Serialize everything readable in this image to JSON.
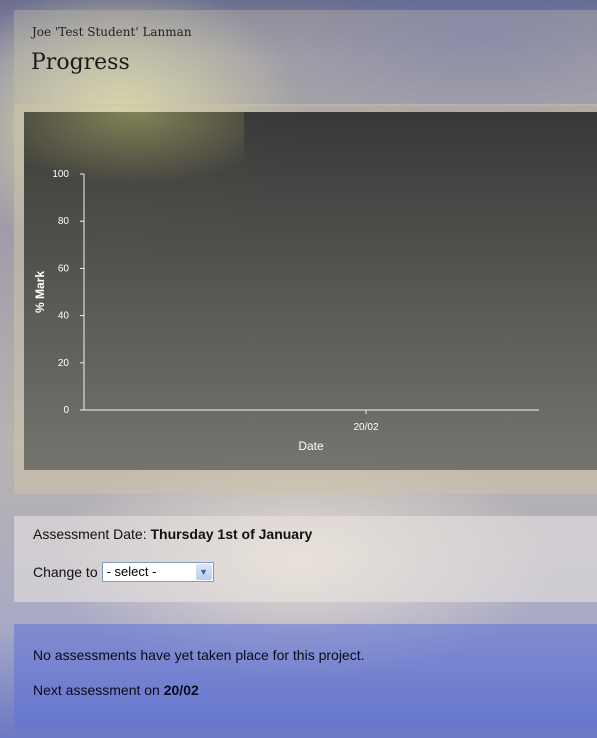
{
  "header": {
    "student_name": "Joe 'Test Student' Lanman",
    "title": "Progress"
  },
  "chart_data": {
    "type": "line",
    "title": "",
    "xlabel": "Date",
    "ylabel": "% Mark",
    "ylim": [
      0,
      100
    ],
    "yticks": [
      "0",
      "20",
      "40",
      "60",
      "80",
      "100"
    ],
    "categories": [
      "20/02"
    ],
    "series": [],
    "grid": false,
    "legend": "none"
  },
  "assessment": {
    "date_label": "Assessment Date: ",
    "date_value": "Thursday 1st of January",
    "change_label": "Change to",
    "select_value": "- select -",
    "select_arrow_icon": "chevron-down-icon"
  },
  "info": {
    "no_assessments": "No assessments have yet taken place for this project.",
    "next_label": "Next assessment on ",
    "next_date": "20/02"
  }
}
